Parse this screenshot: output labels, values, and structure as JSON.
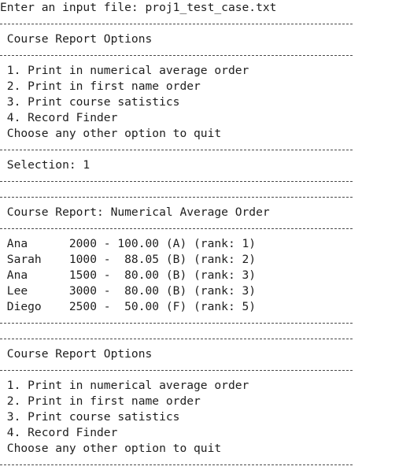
{
  "console": {
    "lines": [
      "Enter an input file: proj1_test_case.txt",
      "-",
      " Course Report Options",
      "-",
      " 1. Print in numerical average order",
      " 2. Print in first name order",
      " 3. Print course satistics",
      " 4. Record Finder",
      " Choose any other option to quit",
      "-",
      " Selection: 1",
      "-",
      "-",
      " Course Report: Numerical Average Order",
      "-",
      " Ana      2000 - 100.00 (A) (rank: 1)",
      " Sarah    1000 -  88.05 (B) (rank: 2)",
      " Ana      1500 -  80.00 (B) (rank: 3)",
      " Lee      3000 -  80.00 (B) (rank: 3)",
      " Diego    2500 -  50.00 (F) (rank: 5)",
      "-",
      "-",
      " Course Report Options",
      "-",
      " 1. Print in numerical average order",
      " 2. Print in first name order",
      " 3. Print course satistics",
      " 4. Record Finder",
      " Choose any other option to quit",
      "-"
    ]
  }
}
